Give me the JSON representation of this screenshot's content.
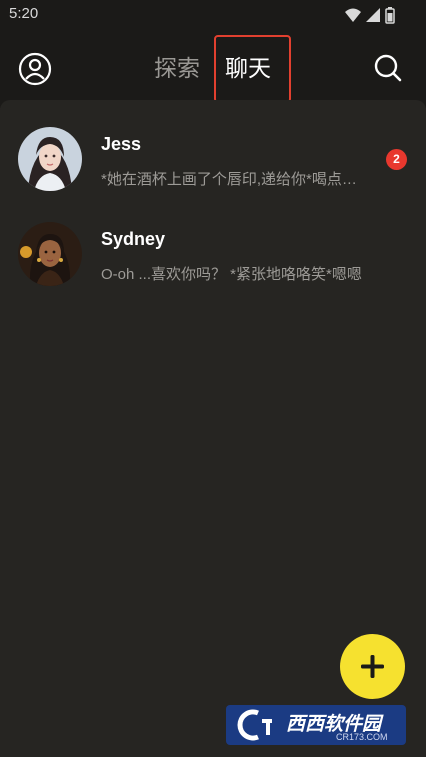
{
  "status_bar": {
    "time": "5:20"
  },
  "header": {
    "tabs": [
      {
        "label": "探索",
        "active": false
      },
      {
        "label": "聊天",
        "active": true
      }
    ]
  },
  "chats": [
    {
      "name": "Jess",
      "preview": "*她在酒杯上画了个唇印,递给你*喝点什么",
      "unread": "2"
    },
    {
      "name": "Sydney",
      "preview": "O-oh ...喜欢你吗？ *紧张地咯咯笑*嗯嗯",
      "unread": ""
    }
  ],
  "watermark": {
    "logo_text": "西西软件园",
    "sub_text": "CR173.COM"
  },
  "colors": {
    "background": "#262522",
    "header_bg": "#1b1a18",
    "fab": "#f6e12f",
    "badge": "#e8382e",
    "highlight": "#e2402f"
  }
}
